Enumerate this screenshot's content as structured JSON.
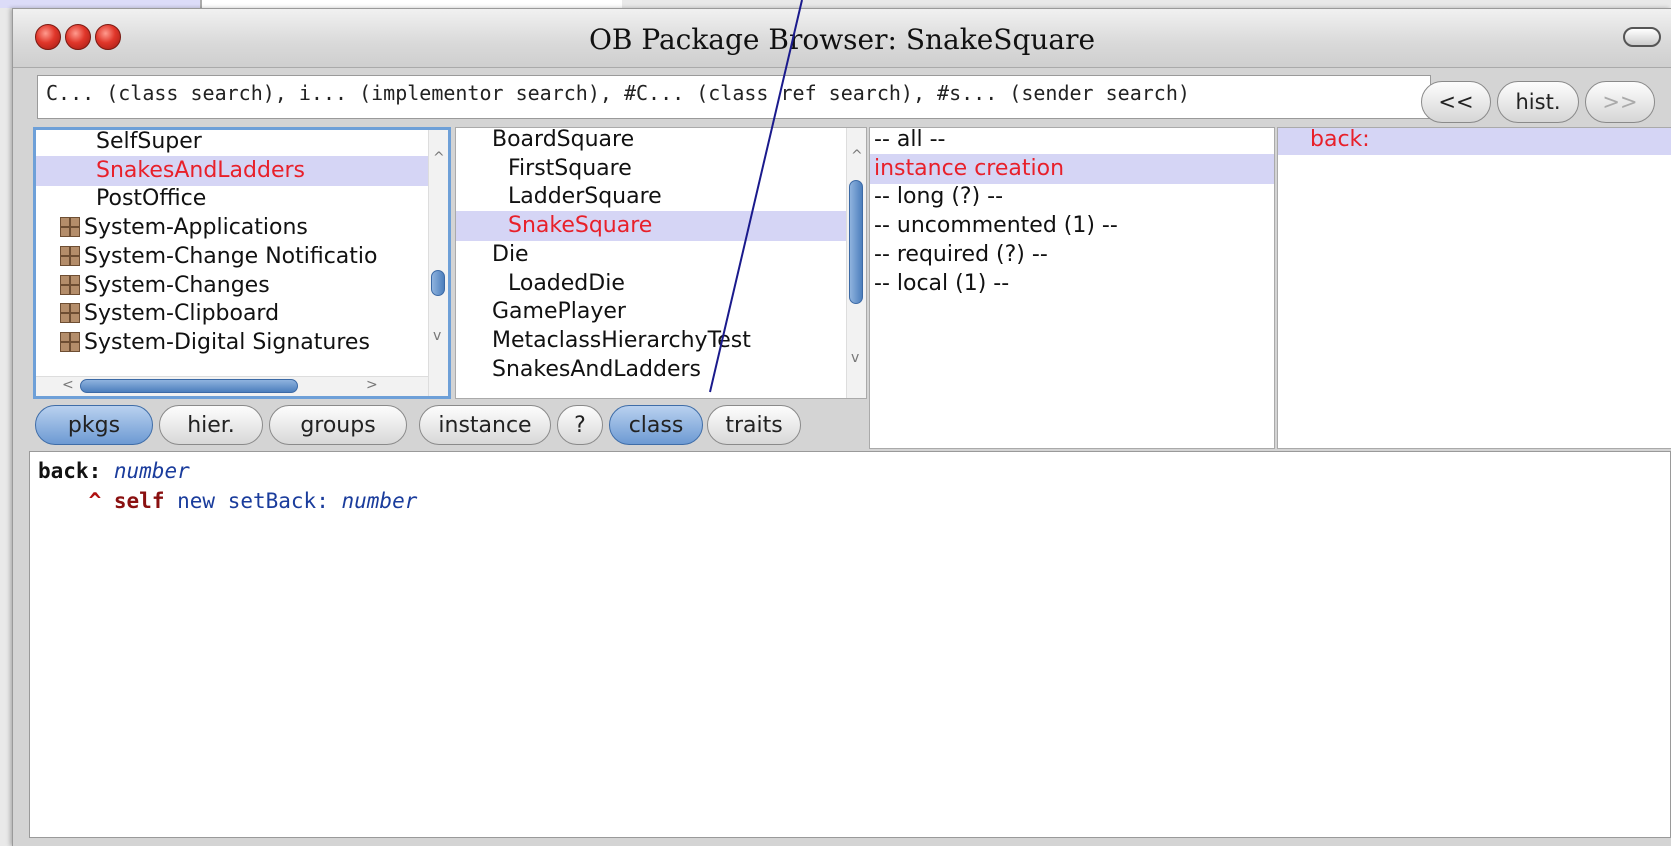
{
  "window": {
    "title": "OB Package Browser: SnakeSquare"
  },
  "search": {
    "value": "C... (class search), i... (implementor search), #C... (class ref search), #s... (sender search)"
  },
  "nav": {
    "back": "<<",
    "history": "hist.",
    "forward": ">>"
  },
  "packages": {
    "items": [
      {
        "label": "SelfSuper",
        "selected": false,
        "has_icon": false
      },
      {
        "label": "SnakesAndLadders",
        "selected": true,
        "has_icon": false
      },
      {
        "label": "PostOffice",
        "selected": false,
        "has_icon": false
      },
      {
        "label": "System-Applications",
        "selected": false,
        "has_icon": true
      },
      {
        "label": "System-Change Notificatio",
        "selected": false,
        "has_icon": true
      },
      {
        "label": "System-Changes",
        "selected": false,
        "has_icon": true
      },
      {
        "label": "System-Clipboard",
        "selected": false,
        "has_icon": true
      },
      {
        "label": "System-Digital Signatures",
        "selected": false,
        "has_icon": true
      }
    ]
  },
  "classes": {
    "items": [
      {
        "label": "BoardSquare",
        "indent": 0,
        "selected": false
      },
      {
        "label": "FirstSquare",
        "indent": 1,
        "selected": false
      },
      {
        "label": "LadderSquare",
        "indent": 1,
        "selected": false
      },
      {
        "label": "SnakeSquare",
        "indent": 1,
        "selected": true
      },
      {
        "label": "Die",
        "indent": 0,
        "selected": false
      },
      {
        "label": "LoadedDie",
        "indent": 1,
        "selected": false
      },
      {
        "label": "GamePlayer",
        "indent": 0,
        "selected": false
      },
      {
        "label": "MetaclassHierarchyTest",
        "indent": 0,
        "selected": false
      },
      {
        "label": "SnakesAndLadders",
        "indent": 0,
        "selected": false
      }
    ]
  },
  "protocols": {
    "items": [
      {
        "label": "-- all --",
        "selected": false
      },
      {
        "label": "instance creation",
        "selected": true
      },
      {
        "label": "-- long (?) --",
        "selected": false
      },
      {
        "label": "-- uncommented (1) --",
        "selected": false
      },
      {
        "label": "-- required (?) --",
        "selected": false
      },
      {
        "label": "-- local (1) --",
        "selected": false
      }
    ]
  },
  "methods": {
    "items": [
      {
        "label": "back:",
        "selected": true
      }
    ]
  },
  "toggles": {
    "pkgs": "pkgs",
    "hier": "hier.",
    "groups": "groups",
    "instance": "instance",
    "help": "?",
    "class": "class",
    "traits": "traits"
  },
  "code": {
    "line1_selector": "back:",
    "line1_arg": "number",
    "line2_caret": "^",
    "line2_self": "self",
    "line2_msg": "new setBack:",
    "line2_arg": "number"
  },
  "colors": {
    "selection_bg": "#d5d5f5",
    "selected_text": "#e8202a",
    "active_toggle": "#6d9ad3"
  }
}
